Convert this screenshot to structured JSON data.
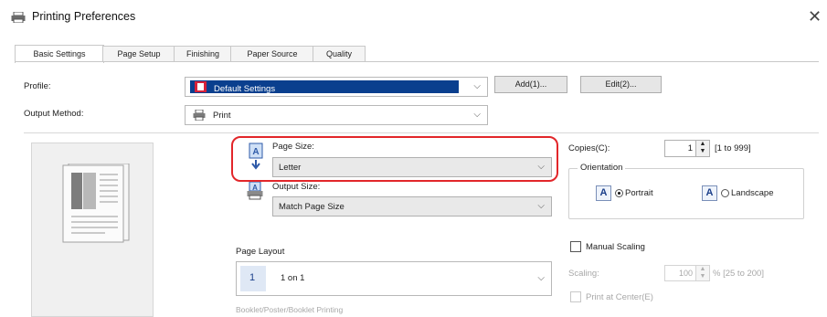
{
  "window": {
    "title": "Printing Preferences",
    "close_glyph": "✕"
  },
  "tabs": [
    {
      "label": "Basic Settings",
      "active": true
    },
    {
      "label": "Page Setup",
      "active": false
    },
    {
      "label": "Finishing",
      "active": false
    },
    {
      "label": "Paper Source",
      "active": false
    },
    {
      "label": "Quality",
      "active": false
    }
  ],
  "profile": {
    "label": "Profile:",
    "value": "Default Settings",
    "add_button": "Add(1)...",
    "edit_button": "Edit(2)..."
  },
  "output_method": {
    "label": "Output Method:",
    "value": "Print"
  },
  "page_size": {
    "label": "Page Size:",
    "value": "Letter"
  },
  "output_size": {
    "label": "Output Size:",
    "value": "Match Page Size"
  },
  "copies": {
    "label": "Copies(C):",
    "value": "1",
    "range": "[1 to 999]"
  },
  "orientation": {
    "label": "Orientation",
    "portrait": "Portrait",
    "landscape": "Landscape",
    "selected": "portrait"
  },
  "page_layout": {
    "label": "Page Layout",
    "value": "1 on 1",
    "number": "1",
    "hint": "Booklet/Poster/Booklet Printing"
  },
  "manual_scaling": {
    "label": "Manual Scaling",
    "checked": false
  },
  "scaling": {
    "label": "Scaling:",
    "value": "100",
    "range": "% [25 to 200]"
  },
  "print_center": {
    "label": "Print at Center(E)"
  },
  "colors": {
    "highlight": "#0a3f8e",
    "red_outline": "#e2262a"
  }
}
